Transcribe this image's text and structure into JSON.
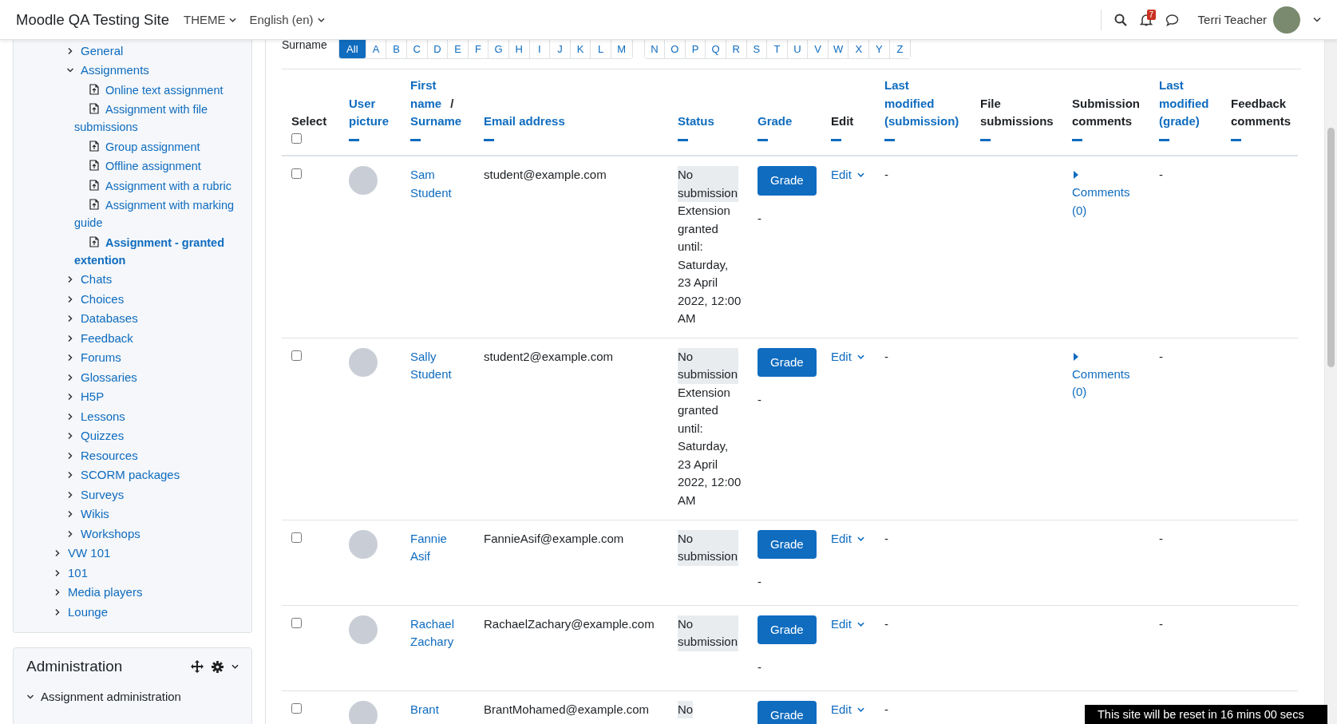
{
  "navbar": {
    "site_name": "Moodle QA Testing Site",
    "menus": [
      {
        "label": "THEME"
      },
      {
        "label": "English (en)"
      }
    ],
    "notification_count": "7",
    "user_name": "Terri Teacher"
  },
  "sidebar": {
    "sections": [
      {
        "label": "General",
        "expanded": false
      },
      {
        "label": "Assignments",
        "expanded": true,
        "children": [
          {
            "label": "Online text assignment",
            "selected": false
          },
          {
            "label": "Assignment with file submissions",
            "selected": false
          },
          {
            "label": "Group assignment",
            "selected": false
          },
          {
            "label": "Offline assignment",
            "selected": false
          },
          {
            "label": "Assignment with a rubric",
            "selected": false
          },
          {
            "label": "Assignment with marking guide",
            "selected": false
          },
          {
            "label": "Assignment - granted extention",
            "selected": true
          }
        ]
      },
      {
        "label": "Chats",
        "expanded": false
      },
      {
        "label": "Choices",
        "expanded": false
      },
      {
        "label": "Databases",
        "expanded": false
      },
      {
        "label": "Feedback",
        "expanded": false
      },
      {
        "label": "Forums",
        "expanded": false
      },
      {
        "label": "Glossaries",
        "expanded": false
      },
      {
        "label": "H5P",
        "expanded": false
      },
      {
        "label": "Lessons",
        "expanded": false
      },
      {
        "label": "Quizzes",
        "expanded": false
      },
      {
        "label": "Resources",
        "expanded": false
      },
      {
        "label": "SCORM packages",
        "expanded": false
      },
      {
        "label": "Surveys",
        "expanded": false
      },
      {
        "label": "Wikis",
        "expanded": false
      },
      {
        "label": "Workshops",
        "expanded": false
      }
    ],
    "courses": [
      {
        "label": "VW 101",
        "expanded": false
      },
      {
        "label": "101",
        "expanded": false
      },
      {
        "label": "Media players",
        "expanded": false
      },
      {
        "label": "Lounge",
        "expanded": false
      }
    ]
  },
  "administration": {
    "title": "Administration",
    "items": [
      {
        "label": "Assignment administration",
        "expanded": true
      }
    ]
  },
  "surname_filter": {
    "label": "Surname",
    "groups": [
      {
        "letters": [
          {
            "label": "All",
            "selected": true
          },
          {
            "label": "A",
            "selected": false
          },
          {
            "label": "B",
            "selected": false
          },
          {
            "label": "C",
            "selected": false
          },
          {
            "label": "D",
            "selected": false
          },
          {
            "label": "E",
            "selected": false
          },
          {
            "label": "F",
            "selected": false
          },
          {
            "label": "G",
            "selected": false
          },
          {
            "label": "H",
            "selected": false
          },
          {
            "label": "I",
            "selected": false
          },
          {
            "label": "J",
            "selected": false
          },
          {
            "label": "K",
            "selected": false
          },
          {
            "label": "L",
            "selected": false
          },
          {
            "label": "M",
            "selected": false
          }
        ]
      },
      {
        "letters": [
          {
            "label": "N",
            "selected": false
          },
          {
            "label": "O",
            "selected": false
          },
          {
            "label": "P",
            "selected": false
          },
          {
            "label": "Q",
            "selected": false
          },
          {
            "label": "R",
            "selected": false
          },
          {
            "label": "S",
            "selected": false
          },
          {
            "label": "T",
            "selected": false
          },
          {
            "label": "U",
            "selected": false
          },
          {
            "label": "V",
            "selected": false
          },
          {
            "label": "W",
            "selected": false
          },
          {
            "label": "X",
            "selected": false
          },
          {
            "label": "Y",
            "selected": false
          },
          {
            "label": "Z",
            "selected": false
          }
        ]
      }
    ]
  },
  "table": {
    "select_all_checked": false,
    "columns": [
      {
        "kind": "select",
        "label": "Select",
        "sortable": false
      },
      {
        "kind": "text",
        "label": "User picture",
        "sortable": true
      },
      {
        "kind": "name",
        "label": "First name",
        "separator": "/",
        "label_2": "Surname",
        "sortable": true
      },
      {
        "kind": "text",
        "label": "Email address",
        "sortable": true
      },
      {
        "kind": "text",
        "label": "Status",
        "sortable": true
      },
      {
        "kind": "text",
        "label": "Grade",
        "sortable": true
      },
      {
        "kind": "text",
        "label": "Edit",
        "sortable": false
      },
      {
        "kind": "text",
        "label": "Last modified (submission)",
        "sortable": true
      },
      {
        "kind": "text",
        "label": "File submissions",
        "sortable": false
      },
      {
        "kind": "text",
        "label": "Submission comments",
        "sortable": false
      },
      {
        "kind": "text",
        "label": "Last modified (grade)",
        "sortable": true
      },
      {
        "kind": "text",
        "label": "Feedback comments",
        "sortable": false
      }
    ],
    "rows": [
      {
        "selected": false,
        "name": "Sam Student",
        "email": "student@example.com",
        "status": "No submission",
        "extension": "Extension granted until: Saturday, 23 April 2022, 12:00 AM",
        "grade_button": "Grade",
        "grade": "-",
        "edit": "Edit",
        "last_modified_submission": "-",
        "comments_link": "Comments (0)",
        "last_modified_grade": "-"
      },
      {
        "selected": false,
        "name": "Sally Student",
        "email": "student2@example.com",
        "status": "No submission",
        "extension": "Extension granted until: Saturday, 23 April 2022, 12:00 AM",
        "grade_button": "Grade",
        "grade": "-",
        "edit": "Edit",
        "last_modified_submission": "-",
        "comments_link": "Comments (0)",
        "last_modified_grade": "-"
      },
      {
        "selected": false,
        "name": "Fannie Asif",
        "email": "FannieAsif@example.com",
        "status": "No submission",
        "grade_button": "Grade",
        "grade": "-",
        "edit": "Edit",
        "last_modified_submission": "-",
        "last_modified_grade": "-"
      },
      {
        "selected": false,
        "name": "Rachael Zachary",
        "email": "RachaelZachary@example.com",
        "status": "No submission",
        "grade_button": "Grade",
        "grade": "-",
        "edit": "Edit",
        "last_modified_submission": "-",
        "last_modified_grade": "-"
      },
      {
        "selected": false,
        "name": "Brant",
        "email": "BrantMohamed@example.com",
        "status": "No",
        "grade_button": "Grade",
        "edit": "Edit",
        "last_modified_submission": "-"
      }
    ]
  },
  "reset_notice": "This site will be reset in 16 mins 00 secs"
}
